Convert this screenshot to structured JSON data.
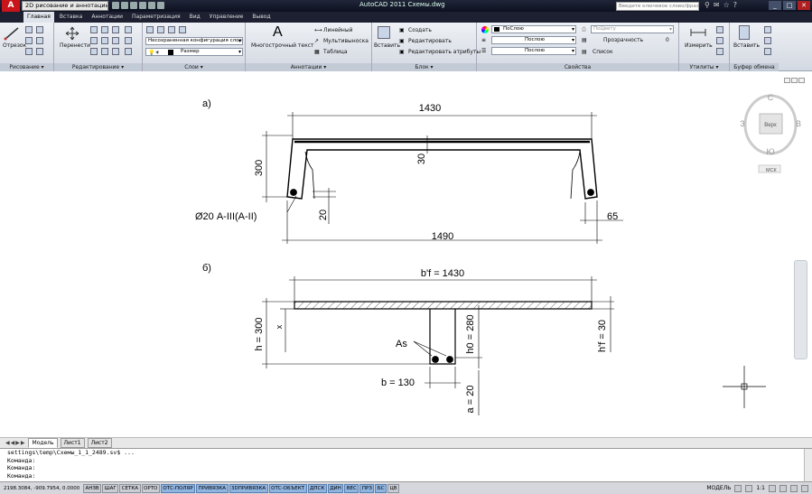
{
  "app": {
    "logo": "A",
    "workspace": "2D рисование и аннотации",
    "title": "AutoCAD 2011    Схемы.dwg",
    "search_placeholder": "Введите ключевое слово/фразу"
  },
  "tabs": [
    "Главная",
    "Вставка",
    "Аннотации",
    "Параметризация",
    "Вид",
    "Управление",
    "Вывод"
  ],
  "ribbon": {
    "draw": {
      "title": "Рисование ▾",
      "line": "Отрезок"
    },
    "modify": {
      "title": "Редактирование ▾",
      "move": "Перенести"
    },
    "layers": {
      "title": "Слои ▾",
      "state": "Несохраненная конфигурация слоев",
      "current": "Размер"
    },
    "annotation": {
      "title": "Аннотации ▾",
      "mtext": "Многострочный текст",
      "linear": "Линейный",
      "multileader": "Мультивыноска",
      "table": "Таблица"
    },
    "block": {
      "title": "Блок ▾",
      "insert": "Вставить",
      "create": "Создать",
      "edit": "Редактировать",
      "edit_attr": "Редактировать атрибуты"
    },
    "properties": {
      "title": "Свойства",
      "color": "ПоСлою",
      "linetype": "Послою",
      "lineweight": "Послою",
      "plotstyle": "ПоЦвету",
      "transparency_label": "Прозрачность",
      "transparency": "0",
      "list": "Список"
    },
    "utilities": {
      "title": "Утилиты ▾",
      "measure": "Измерить"
    },
    "clipboard": {
      "title": "Буфер обмена",
      "paste": "Вставить"
    }
  },
  "viewcube": {
    "n": "С",
    "s": "Ю",
    "w": "З",
    "e": "В",
    "face": "Верх",
    "ucs": "МСК"
  },
  "drawing": {
    "label_a": "а)",
    "label_b": "б)",
    "dim_top": "1430",
    "dim_height": "300",
    "dim_wall": "30",
    "dim_cover": "20",
    "dim_side": "65",
    "dim_bottom": "1490",
    "rebar": "Ø20 А-III(А-II)",
    "dim_bf": "b'f = 1430",
    "dim_h": "h = 300",
    "x_label": "x",
    "dim_h0": "h0 = 280",
    "dim_hf": "h'f = 30",
    "as_label": "As",
    "dim_b": "b = 130",
    "dim_a": "a = 20"
  },
  "layout_tabs": [
    "Модель",
    "Лист1",
    "Лист2"
  ],
  "command": {
    "lines": [
      "settings\\temp\\Схемы_1_1_2489.sv$ ...",
      "Команда:",
      "Команда:",
      "Команда:"
    ]
  },
  "status": {
    "coords": "2198.3084, -909.7954, 0.0000",
    "buttons": [
      "АНЗВ",
      "ШАГ",
      "СЕТКА",
      "ОРТО",
      "ОТС-ПОЛЯР",
      "ПРИВЯЗКА",
      "3DПРИВЯЗКА",
      "ОТС-ОБЪЕКТ",
      "ДПСК",
      "ДИН",
      "ВЕС",
      "ПРЗ",
      "БС",
      "ЦВ"
    ],
    "on": [
      "ОТС-ПОЛЯР",
      "ПРИВЯЗКА",
      "3DПРИВЯЗКА",
      "ОТС-ОБЪЕКТ",
      "ДПСК",
      "ДИН",
      "ВЕС",
      "ПРЗ",
      "БС"
    ],
    "model": "МОДЕЛЬ",
    "scale": "1:1"
  }
}
